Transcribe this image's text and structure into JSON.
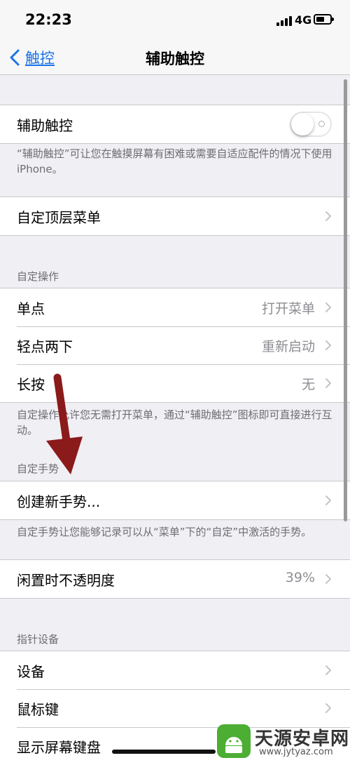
{
  "status": {
    "time": "22:23",
    "network": "4G"
  },
  "nav": {
    "back_label": "触控",
    "title": "辅助触控"
  },
  "toggle_row": {
    "label": "辅助触控",
    "on": false,
    "footer": "“辅助触控”可让您在触摸屏幕有困难或需要自适应配件的情况下使用iPhone。"
  },
  "top_menu": {
    "label": "自定顶层菜单"
  },
  "custom_actions": {
    "header": "自定操作",
    "rows": [
      {
        "label": "单点",
        "value": "打开菜单"
      },
      {
        "label": "轻点两下",
        "value": "重新启动"
      },
      {
        "label": "长按",
        "value": "无"
      }
    ],
    "footer": "自定操作允许您无需打开菜单，通过“辅助触控”图标即可直接进行互动。"
  },
  "custom_gestures": {
    "header": "自定手势",
    "create_label": "创建新手势...",
    "footer": "自定手势让您能够记录可以从“菜单”下的“自定”中激活的手势。"
  },
  "idle_opacity": {
    "label": "闲置时不透明度",
    "value": "39%"
  },
  "pointer_devices": {
    "header": "指针设备",
    "rows": [
      {
        "label": "设备"
      },
      {
        "label": "鼠标键"
      },
      {
        "label": "显示屏幕键盘"
      }
    ]
  },
  "watermark": {
    "name": "天源安卓网",
    "url": "www.jytyaz.com"
  },
  "colors": {
    "accent": "#1a73e8",
    "annotation_arrow": "#8b1a1a",
    "background": "#efeff4"
  }
}
